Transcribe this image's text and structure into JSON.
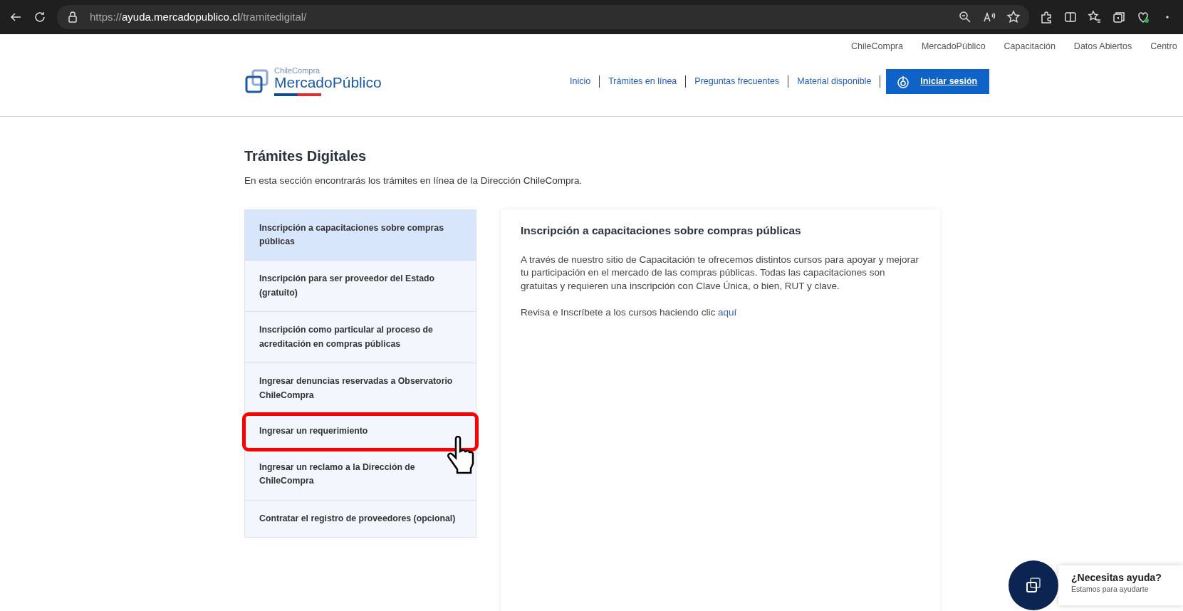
{
  "browser": {
    "url": {
      "scheme": "https://",
      "host": "ayuda.mercadopublico.cl",
      "path": "/tramitedigital/"
    }
  },
  "top_links": [
    "ChileCompra",
    "MercadoPúblico",
    "Capacitación",
    "Datos Abiertos",
    "Centro"
  ],
  "logo": {
    "small": "ChileCompra",
    "name": "MercadoPúblico"
  },
  "nav": [
    "Inicio",
    "Trámites en línea",
    "Preguntas frecuentes",
    "Material disponible"
  ],
  "login": "Iniciar sesión",
  "page": {
    "title": "Trámites Digitales",
    "intro": "En esta sección encontrarás los trámites en línea de la Dirección ChileCompra."
  },
  "items": [
    {
      "label": "Inscripción a capacitaciones sobre compras públicas",
      "selected": true,
      "highlighted": false
    },
    {
      "label": "Inscripción para ser proveedor del Estado (gratuito)",
      "selected": false,
      "highlighted": false
    },
    {
      "label": "Inscripción como particular al proceso de acreditación en compras públicas",
      "selected": false,
      "highlighted": false
    },
    {
      "label": "Ingresar denuncias reservadas a Observatorio ChileCompra",
      "selected": false,
      "highlighted": false
    },
    {
      "label": "Ingresar un requerimiento",
      "selected": false,
      "highlighted": true
    },
    {
      "label": "Ingresar un reclamo a la Dirección de ChileCompra",
      "selected": false,
      "highlighted": false
    },
    {
      "label": "Contratar el registro de proveedores (opcional)",
      "selected": false,
      "highlighted": false
    }
  ],
  "panel": {
    "title": "Inscripción a capacitaciones sobre compras públicas",
    "body": "A través de nuestro sitio de Capacitación te ofrecemos distintos cursos para apoyar y mejorar tu participación en el mercado de las compras públicas. Todas las capacitaciones son gratuitas y requieren una inscripción con Clave Única, o bien, RUT y clave.",
    "link_text": "Revisa e Inscríbete a los cursos haciendo clic",
    "link": "aquí"
  },
  "help": {
    "title": "¿Necesitas ayuda?",
    "subtitle": "Estamos para ayudarte"
  }
}
